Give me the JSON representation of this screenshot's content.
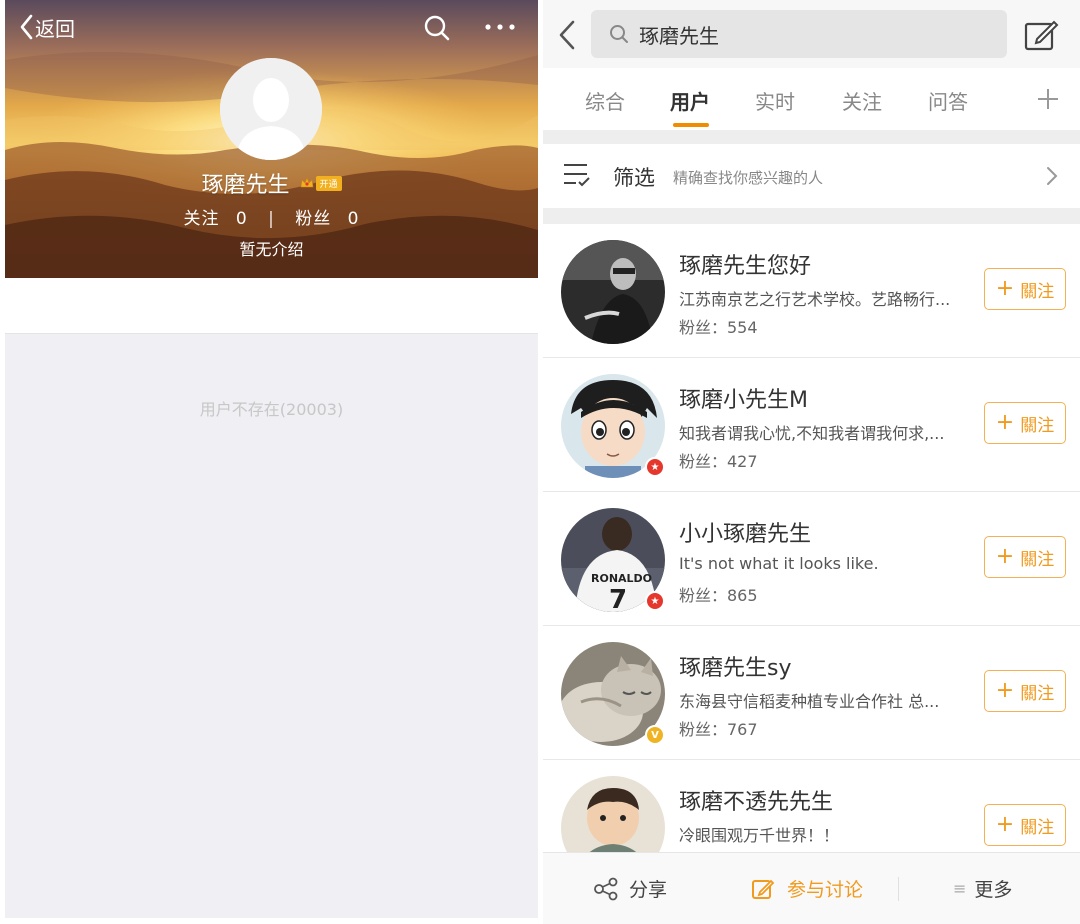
{
  "left": {
    "back_label": "返回",
    "profile": {
      "name": "琢磨先生",
      "vip_tag": "开通",
      "follow_label": "关注",
      "follow_count": "0",
      "stat_separator": "|",
      "fans_label": "粉丝",
      "fans_count": "0",
      "intro": "暂无介绍"
    },
    "error_message": "用户不存在(20003)"
  },
  "right": {
    "search_query": "琢磨先生",
    "tabs": [
      {
        "label": "综合",
        "active": false
      },
      {
        "label": "用户",
        "active": true
      },
      {
        "label": "实时",
        "active": false
      },
      {
        "label": "关注",
        "active": false
      },
      {
        "label": "问答",
        "active": false
      }
    ],
    "filter": {
      "label": "筛选",
      "hint": "精确查找你感兴趣的人"
    },
    "follow_label": "關注",
    "users": [
      {
        "name": "琢磨先生您好",
        "desc": "江苏南京艺之行艺术学校。艺路畅行...",
        "fans": "粉丝：554",
        "badge": ""
      },
      {
        "name": "琢磨小先生M",
        "desc": "知我者谓我心忧,不知我者谓我何求,...",
        "fans": "粉丝：427",
        "badge": "red"
      },
      {
        "name": "小小琢磨先生",
        "desc": "It's not what it looks like.",
        "fans": "粉丝：865",
        "badge": "red"
      },
      {
        "name": "琢磨先生sy",
        "desc": "东海县守信稻麦种植专业合作社 总...",
        "fans": "粉丝：767",
        "badge": "gold"
      },
      {
        "name": "琢磨不透先先生",
        "desc": "冷眼围观万千世界！！",
        "fans": "",
        "badge": ""
      }
    ],
    "bottom": {
      "share": "分享",
      "discuss": "参与讨论",
      "more": "更多"
    },
    "colors": {
      "accent": "#f18b00",
      "follow_border": "#f3b054",
      "badge_red": "#e5372c",
      "badge_gold": "#f0b323"
    }
  }
}
